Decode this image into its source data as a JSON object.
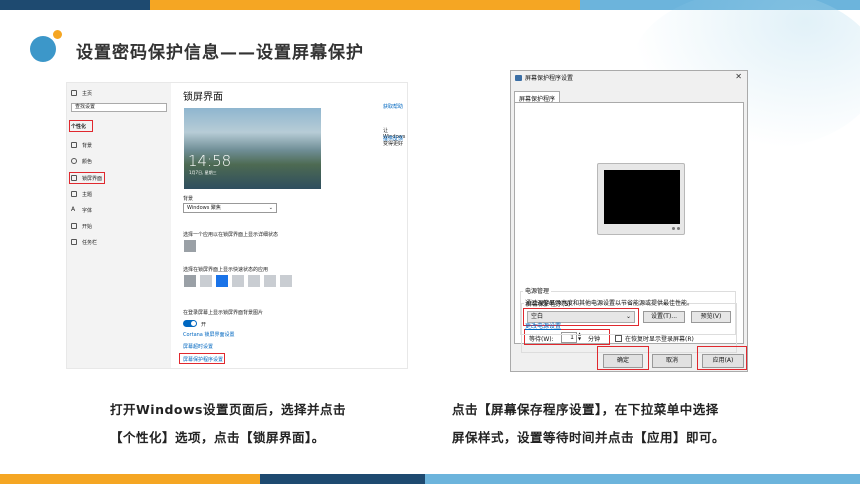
{
  "slide": {
    "title": "设置密码保护信息——设置屏幕保护",
    "colors": {
      "orange": "#f5a623",
      "blue": "#5aa7d3",
      "navy": "#1e4a70",
      "red": "#e0282e"
    }
  },
  "left": {
    "sidebar": {
      "home": "主页",
      "search": "查找设置",
      "section": "个性化",
      "items": [
        "背景",
        "颜色",
        "锁屏界面",
        "主题",
        "字体",
        "开始",
        "任务栏"
      ]
    },
    "page_title": "锁屏界面",
    "preview_time": "14:58",
    "preview_date": "1月7日, 星期三",
    "background_label": "背景",
    "background_value": "Windows 聚焦",
    "detail_label": "选择一个应用以在锁屏界面上显示详细状态",
    "quick_label": "选择在锁屏界面上显示快速状态的应用",
    "signin_label": "在登录屏幕上显示锁屏界面背景图片",
    "toggle_value": "开",
    "cortana_link": "Cortana 锁屏界面设置",
    "timeout_link": "屏幕超时设置",
    "screensaver_link": "屏幕保护程序设置",
    "help_link": "获取帮助",
    "windows_better": "让 Windows 变得更好",
    "feedback_link": "提供反馈"
  },
  "dialog": {
    "title": "屏幕保护程序设置",
    "tab": "屏幕保护程序",
    "group_label": "屏幕保护程序(S)",
    "saver_value": "空白",
    "settings_button": "设置(T)...",
    "preview_button": "预览(V)",
    "wait_label": "等待(W):",
    "wait_value": "1",
    "wait_unit": "分钟",
    "resume_label": "在恢复时显示登录屏幕(R)",
    "power_label": "电源管理",
    "power_desc": "通过调整显示亮度和其他电源设置以节省能源或提供最佳性能。",
    "power_link": "更改电源设置",
    "ok": "确定",
    "cancel": "取消",
    "apply": "应用(A)"
  },
  "captions": {
    "left_line1": "打开Windows设置页面后，选择并点击",
    "left_line2": "【个性化】选项，点击【锁屏界面】。",
    "right_line1": "点击【屏幕保存程序设置】，在下拉菜单中选择",
    "right_line2": "屏保样式，设置等待时间并点击【应用】即可。"
  }
}
